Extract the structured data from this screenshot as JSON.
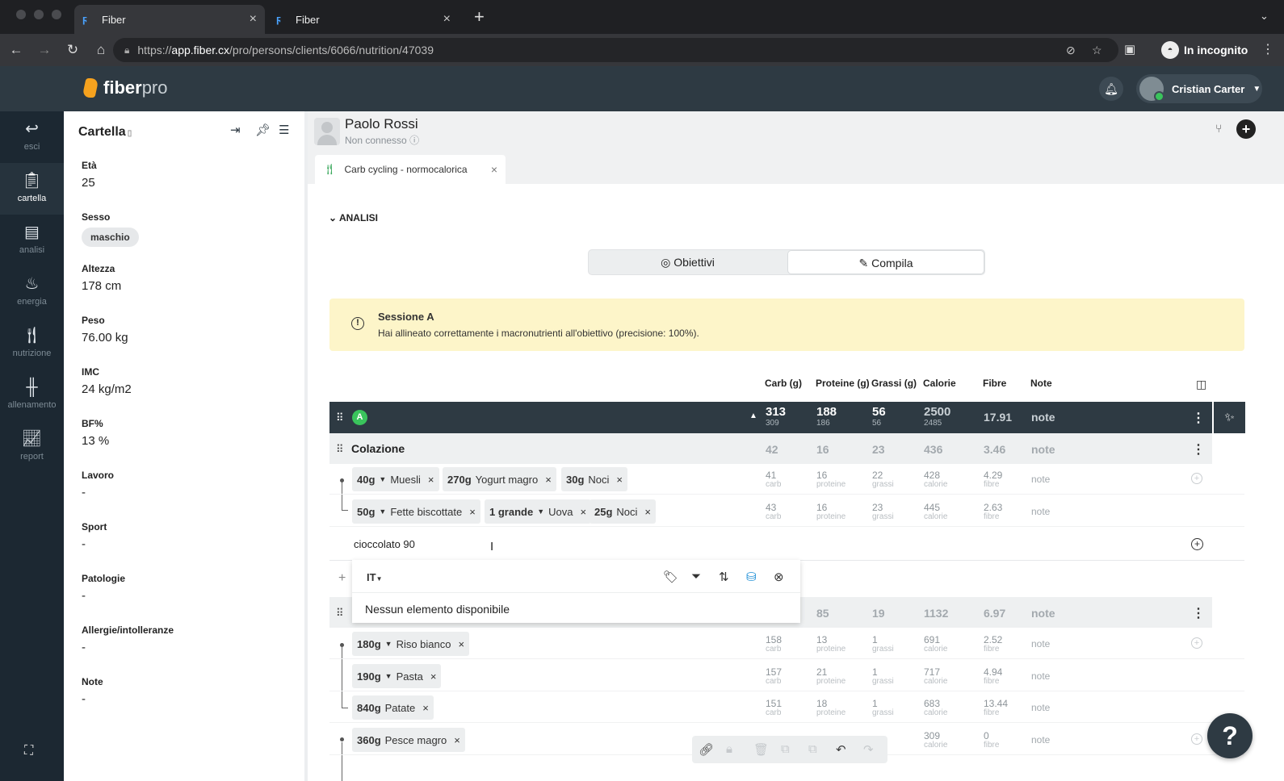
{
  "browser": {
    "tabs": [
      {
        "title": "Fiber",
        "active": true
      },
      {
        "title": "Fiber",
        "active": false
      }
    ],
    "url_scheme": "https://",
    "url_host": "app.fiber.cx",
    "url_path": "/pro/persons/clients/6066/nutrition/47039",
    "incognito_label": "In incognito"
  },
  "app": {
    "logo_text": "fiber",
    "logo_suffix": "pro",
    "user_name": "Cristian Carter",
    "accent_color": "#f6a21e",
    "header_color": "#2e3a43"
  },
  "nav": {
    "items": [
      {
        "label": "esci",
        "icon": "back-arrow-icon"
      },
      {
        "label": "cartella",
        "icon": "clipboard-icon"
      },
      {
        "label": "analisi",
        "icon": "document-icon"
      },
      {
        "label": "energia",
        "icon": "flame-icon"
      },
      {
        "label": "nutrizione",
        "icon": "fork-knife-icon"
      },
      {
        "label": "allenamento",
        "icon": "dumbbell-icon"
      },
      {
        "label": "report",
        "icon": "chart-line-icon"
      }
    ]
  },
  "cartella": {
    "title": "Cartella",
    "fields": [
      {
        "label": "Età",
        "value": "25"
      },
      {
        "label": "Sesso",
        "value": "maschio"
      },
      {
        "label": "Altezza",
        "value": "178 cm"
      },
      {
        "label": "Peso",
        "value": "76.00 kg"
      },
      {
        "label": "IMC",
        "value": "24 kg/m2"
      },
      {
        "label": "BF%",
        "value": "13 %"
      },
      {
        "label": "Lavoro",
        "value": "-"
      },
      {
        "label": "Sport",
        "value": "-"
      },
      {
        "label": "Patologie",
        "value": "-"
      },
      {
        "label": "Allergie/intolleranze",
        "value": "-"
      },
      {
        "label": "Note",
        "value": "-"
      }
    ]
  },
  "patient": {
    "name": "Paolo Rossi",
    "status": "Non connesso",
    "plan_tab": "Carb cycling - normocalorica"
  },
  "analysis": {
    "section_label": "ANALISI",
    "toggle": {
      "left": "Obiettivi",
      "right": "Compila",
      "selected": "Compila"
    },
    "alert_title": "Sessione A",
    "alert_message": "Hai allineato correttamente i macronutrienti all'obiettivo (precisione: 100%)."
  },
  "columns": [
    "Carb (g)",
    "Proteine (g)",
    "Grassi (g)",
    "Calorie",
    "Fibre",
    "Note"
  ],
  "session": {
    "badge": "A",
    "carb": "313",
    "carb_target": "309",
    "prot": "188",
    "prot_target": "186",
    "fat": "56",
    "fat_target": "56",
    "cal": "2500",
    "cal_target": "2485",
    "fibre": "17.91",
    "note": "note"
  },
  "meals": [
    {
      "name": "Colazione",
      "carb": "42",
      "prot": "16",
      "fat": "23",
      "cal": "436",
      "fibre": "3.46",
      "note": "note",
      "rows": [
        {
          "foods": [
            {
              "qty": "40g",
              "name": "Muesli",
              "has_menu": true
            },
            {
              "qty": "270g",
              "name": "Yogurt magro",
              "has_menu": false
            },
            {
              "qty": "30g",
              "name": "Noci",
              "has_menu": false
            }
          ],
          "carb": "41",
          "prot": "16",
          "fat": "22",
          "cal": "428",
          "fibre": "4.29",
          "note": "note"
        },
        {
          "foods": [
            {
              "qty": "50g",
              "name": "Fette biscottate",
              "has_menu": true
            },
            {
              "qty": "1 grande",
              "name": "Uova",
              "has_menu": true
            },
            {
              "qty": "25g",
              "name": "Noci",
              "has_menu": false
            }
          ],
          "carb": "43",
          "prot": "16",
          "fat": "23",
          "cal": "445",
          "fibre": "2.63",
          "note": "note"
        }
      ]
    },
    {
      "name": "",
      "carb": "",
      "prot": "85",
      "fat": "19",
      "cal": "1132",
      "fibre": "6.97",
      "note": "note",
      "rows": [
        {
          "foods": [
            {
              "qty": "180g",
              "name": "Riso bianco",
              "has_menu": true
            }
          ],
          "carb": "158",
          "prot": "13",
          "fat": "1",
          "cal": "691",
          "fibre": "2.52",
          "note": "note"
        },
        {
          "foods": [
            {
              "qty": "190g",
              "name": "Pasta",
              "has_menu": true
            }
          ],
          "carb": "157",
          "prot": "21",
          "fat": "1",
          "cal": "717",
          "fibre": "4.94",
          "note": "note"
        },
        {
          "foods": [
            {
              "qty": "840g",
              "name": "Patate",
              "has_menu": false
            }
          ],
          "carb": "151",
          "prot": "18",
          "fat": "1",
          "cal": "683",
          "fibre": "13.44",
          "note": "note"
        },
        {
          "foods": [
            {
              "qty": "360g",
              "name": "Pesce magro",
              "has_menu": false
            }
          ],
          "carb": "",
          "prot": "",
          "fat": "",
          "cal": "309",
          "fibre": "0",
          "note": "note"
        }
      ]
    }
  ],
  "units": {
    "carb": "carb",
    "prot": "proteine",
    "fat": "grassi",
    "cal": "calorie",
    "fibre": "fibre"
  },
  "search": {
    "value": "cioccolato 90",
    "language": "IT",
    "empty_message": "Nessun elemento disponibile"
  }
}
